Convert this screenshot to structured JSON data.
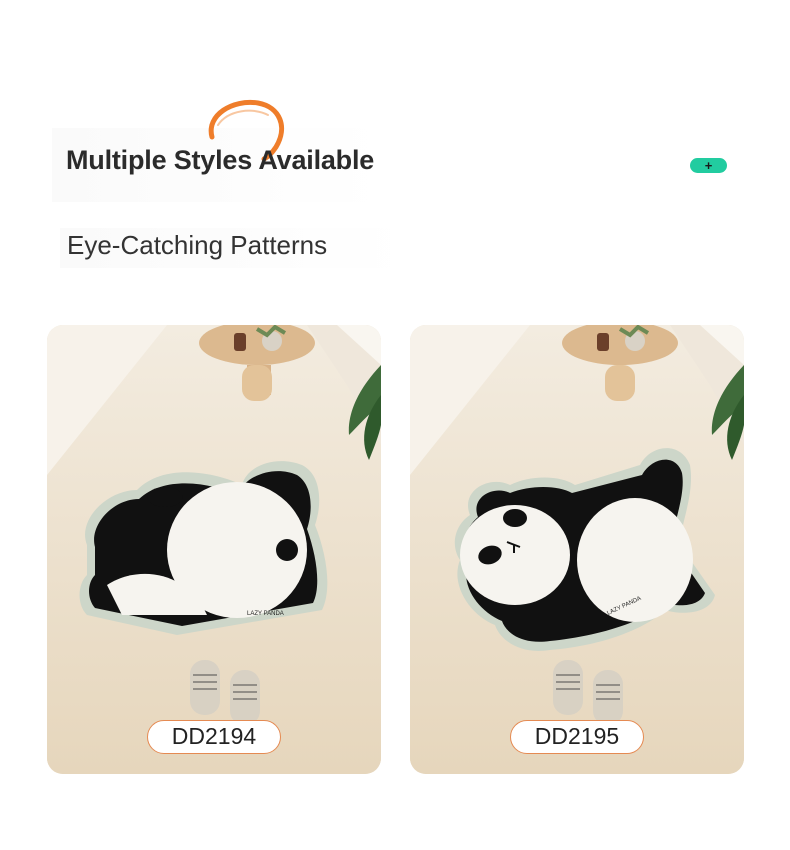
{
  "header": {
    "title": "Multiple Styles Available",
    "subtitle": "Eye-Catching Patterns",
    "badge_symbol": "+",
    "accent_color": "#ef7d2a",
    "badge_color": "#22cca0"
  },
  "products": [
    {
      "code": "DD2194",
      "mat_text": "LAZY PANDA",
      "icon": "panda-lying-mat"
    },
    {
      "code": "DD2195",
      "mat_text": "LAZY PANDA",
      "icon": "panda-stretching-mat"
    }
  ],
  "colors": {
    "pill_border": "#e58a52",
    "floor": "#e9ddc9"
  }
}
